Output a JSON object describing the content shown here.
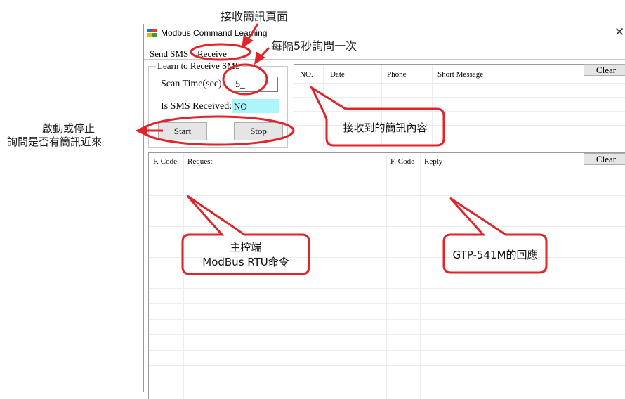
{
  "window": {
    "title": "Modbus Command Learning",
    "close_glyph": "✕",
    "tabs": [
      {
        "label": "Send SMS",
        "selected": false
      },
      {
        "label": "Receive SMS",
        "selected": true
      }
    ]
  },
  "learn_group": {
    "title": "Learn to Receive SMS",
    "scan_time_label": "Scan Time(sec):",
    "scan_time_value": "5_",
    "sms_received_label": "Is SMS Received:",
    "sms_received_value": "NO",
    "start_label": "Start",
    "stop_label": "Stop"
  },
  "sms_table": {
    "columns": [
      "NO.",
      "Date",
      "Phone",
      "Short Message"
    ],
    "clear_label": "Clear"
  },
  "modbus_table": {
    "columns": [
      "F. Code",
      "Request",
      "F. Code",
      "Reply"
    ],
    "clear_label": "Clear"
  },
  "annotations": {
    "receive_page": "接收簡訊頁面",
    "scan_interval": "每隔5秒詢問一次",
    "start_stop_line1": "啟動或停止",
    "start_stop_line2": "詢問是否有簡訊近來",
    "received_content": "接收到的簡訊內容",
    "master_line1": "主控端",
    "master_line2": "ModBus RTU命令",
    "reply": "GTP-541M的回應"
  },
  "colors": {
    "annotation_red": "#e0242a",
    "sms_received_bg": "#aef5fb",
    "button_bg": "#e5e5e5"
  }
}
